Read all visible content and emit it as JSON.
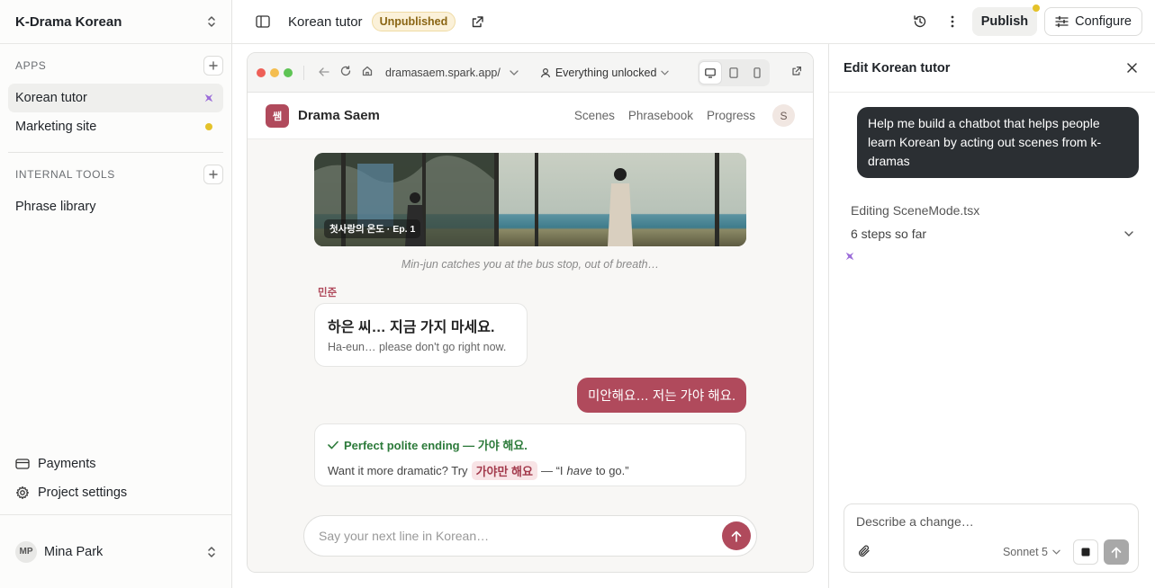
{
  "sidebar": {
    "workspace": "K-Drama Korean",
    "apps_label": "APPS",
    "apps": [
      {
        "label": "Korean tutor"
      },
      {
        "label": "Marketing site"
      }
    ],
    "tools_label": "INTERNAL TOOLS",
    "tools": [
      {
        "label": "Phrase library"
      }
    ],
    "footer": [
      {
        "label": "Payments",
        "icon": "card-icon"
      },
      {
        "label": "Project settings",
        "icon": "gear-icon"
      }
    ],
    "user": {
      "initials": "MP",
      "name": "Mina Park"
    }
  },
  "topbar": {
    "title": "Korean tutor",
    "status": "Unpublished",
    "publish_label": "Publish",
    "configure_label": "Configure"
  },
  "browser": {
    "url": "dramasaem.spark.app/",
    "access": "Everything unlocked"
  },
  "app": {
    "logo": "쌤",
    "name": "Drama Saem",
    "nav": [
      "Scenes",
      "Phrasebook",
      "Progress"
    ],
    "avatar": "S",
    "scene_tag": "첫사랑의 온도 · Ep. 1",
    "caption": "Min-jun catches you at the bus stop, out of breath…",
    "speaker": "민준",
    "line_ko": "하은 씨… 지금 가지 마세요.",
    "line_en": "Ha-eun… please don't go right now.",
    "reply": "미안해요… 저는 가야 해요.",
    "feedback": {
      "title": "Perfect polite ending — 가야 해요.",
      "prefix": "Want it more dramatic? Try",
      "chip": "가야만 해요",
      "suffix_a": "— “I",
      "suffix_em": "have",
      "suffix_b": "to go.”"
    },
    "composer_placeholder": "Say your next line in Korean…"
  },
  "panel": {
    "title": "Edit Korean tutor",
    "user_message": "Help me build a chatbot that helps people learn Korean by acting out scenes from k-dramas",
    "editing": "Editing SceneMode.tsx",
    "steps": "6 steps so far",
    "composer_placeholder": "Describe a change…",
    "model": "Sonnet 5"
  },
  "colors": {
    "accent_rose": "#b04a5c",
    "status_yellow": "#e4c22a",
    "success_green": "#2c7a3a",
    "spark_purple": "#9b6cd9"
  }
}
